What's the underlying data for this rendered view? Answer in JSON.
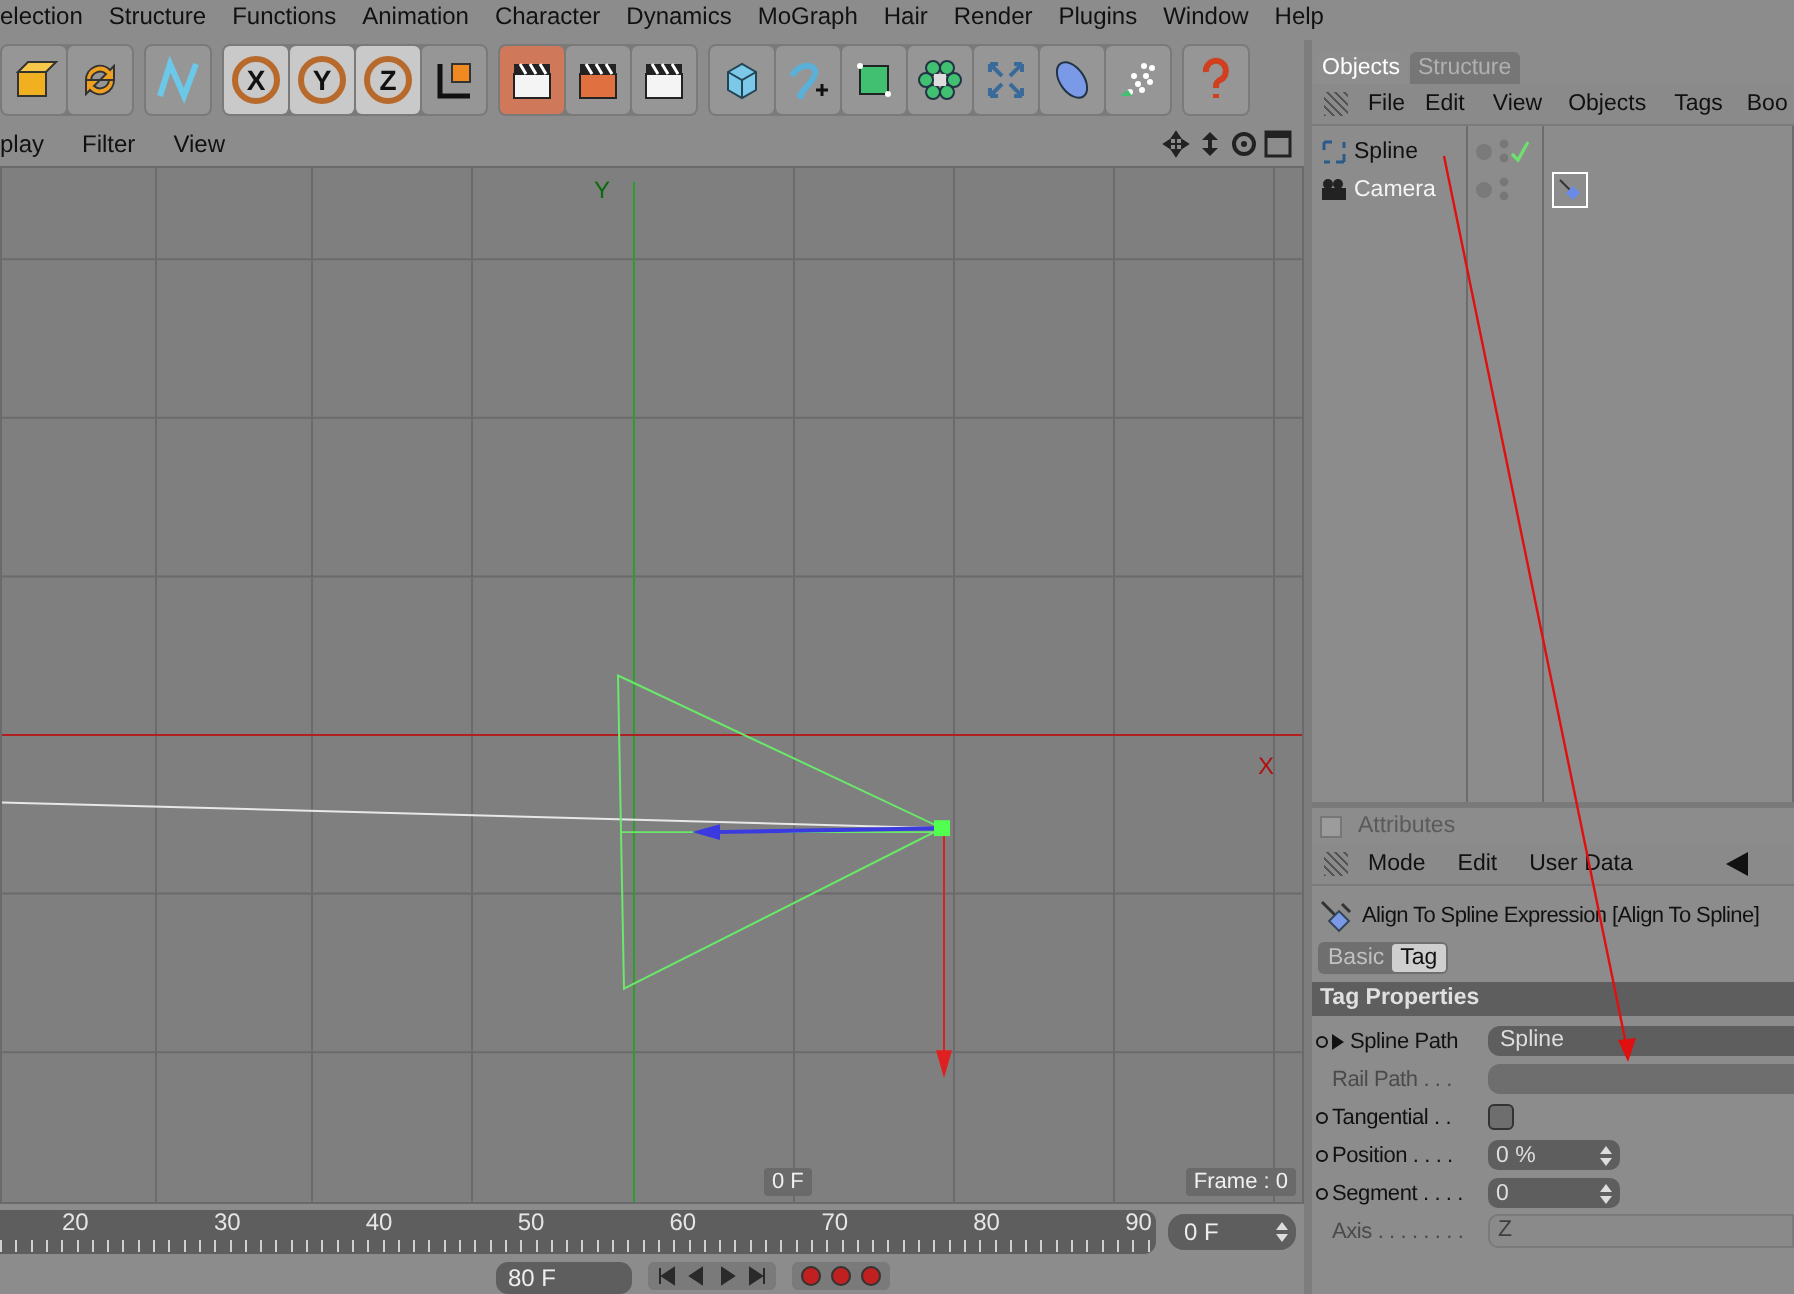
{
  "menu_bar": [
    "election",
    "Structure",
    "Functions",
    "Animation",
    "Character",
    "Dynamics",
    "MoGraph",
    "Hair",
    "Render",
    "Plugins",
    "Window",
    "Help"
  ],
  "toolbar": [
    {
      "buttons": [
        {
          "kind": "tool",
          "selected": false
        },
        {
          "kind": "tool",
          "selected": false
        }
      ]
    },
    {
      "buttons": [
        {
          "kind": "tool",
          "selected": false
        }
      ]
    },
    {
      "buttons": [
        {
          "kind": "axis",
          "label": "X",
          "selected": true
        },
        {
          "kind": "axis",
          "label": "Y",
          "selected": true
        },
        {
          "kind": "axis",
          "label": "Z",
          "selected": true
        },
        {
          "kind": "tool",
          "selected": false
        }
      ]
    },
    {
      "buttons": [
        {
          "kind": "tool",
          "selected": true
        },
        {
          "kind": "tool",
          "selected": false
        },
        {
          "kind": "tool",
          "selected": false
        }
      ]
    },
    {
      "buttons": [
        {
          "kind": "tool",
          "selected": false
        },
        {
          "kind": "tool",
          "selected": false
        },
        {
          "kind": "tool",
          "selected": false
        },
        {
          "kind": "tool",
          "selected": false
        },
        {
          "kind": "tool",
          "selected": false
        },
        {
          "kind": "tool",
          "selected": false
        },
        {
          "kind": "tool",
          "selected": false
        }
      ]
    },
    {
      "buttons": [
        {
          "kind": "tool",
          "selected": false
        }
      ]
    }
  ],
  "viewport": {
    "menu": [
      "play",
      "Filter",
      "View"
    ],
    "y_axis_label": "Y",
    "x_axis_label": "X",
    "frame_badge": "0 F",
    "frame_counter": "Frame : 0"
  },
  "timeline": {
    "ticks": [
      "20",
      "30",
      "40",
      "50",
      "60",
      "70",
      "80",
      "90"
    ],
    "current_frame": "0 F"
  },
  "playback": {
    "end_frame": "80 F"
  },
  "object_manager": {
    "tabs": [
      {
        "label": "Objects",
        "selected": true
      },
      {
        "label": "Structure",
        "selected": false
      }
    ],
    "menu": [
      "File",
      "Edit",
      "View",
      "Objects",
      "Tags",
      "Boo"
    ],
    "objects": [
      {
        "name": "Spline",
        "selected": false,
        "enabled": true
      },
      {
        "name": "Camera",
        "selected": true,
        "enabled": false,
        "tags": [
          {
            "selected": true
          }
        ]
      }
    ]
  },
  "attributes": {
    "title": "Attributes",
    "menu": [
      "Mode",
      "Edit",
      "User Data"
    ],
    "object_title": "Align To Spline Expression [Align To Spline]",
    "tabs": [
      {
        "label": "Basic",
        "selected": false
      },
      {
        "label": "Tag",
        "selected": true
      }
    ],
    "section": "Tag Properties",
    "properties": [
      {
        "kind": "link",
        "label": "Spline Path",
        "value": "Spline",
        "disabled": false,
        "expandable": true
      },
      {
        "kind": "link",
        "label": "Rail Path . . .",
        "disabled": true,
        "expandable": false
      },
      {
        "kind": "checkbox",
        "label": "Tangential . .",
        "checked": false,
        "disabled": false,
        "expandable": false
      },
      {
        "kind": "number",
        "label": "Position . . . .",
        "value": "0 %",
        "disabled": false,
        "expandable": false
      },
      {
        "kind": "number",
        "label": "Segment . . . .",
        "value": "0",
        "disabled": false,
        "expandable": false
      },
      {
        "kind": "dropdown",
        "label": "Axis . . . . . . . .",
        "value": "Z",
        "disabled": true,
        "expandable": false
      }
    ]
  }
}
